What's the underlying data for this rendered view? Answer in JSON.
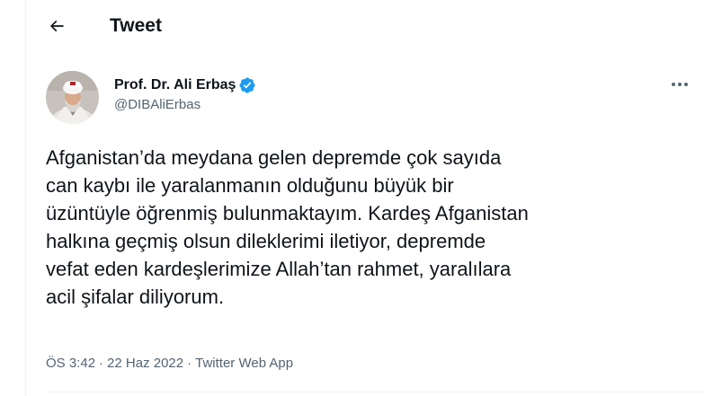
{
  "header": {
    "title": "Tweet",
    "back_icon": "arrow-left-icon"
  },
  "author": {
    "display_name": "Prof. Dr. Ali Erbaş",
    "handle": "@DIBAliErbas",
    "verified_icon": "verified-badge-icon",
    "verified_color": "#1d9bf0"
  },
  "more_icon": "more-horizontal-icon",
  "tweet": {
    "text": "Afganistan’da meydana gelen depremde çok sayıda\ncan kaybı ile yaralanmanın olduğunu büyük bir\nüzüntüyle öğrenmiş bulunmaktayım. Kardeş Afganistan\nhalkına geçmiş olsun dileklerimi iletiyor,  depremde\nvefat eden kardeşlerimize Allah’tan rahmet, yaralılara\nacil şifalar diliyorum."
  },
  "meta": {
    "time": "ÖS 3:42",
    "separator": "·",
    "date": "22 Haz 2022",
    "source": "Twitter Web App"
  },
  "colors": {
    "text_primary": "#0f1419",
    "text_secondary": "#536471",
    "border": "#eff3f4"
  }
}
